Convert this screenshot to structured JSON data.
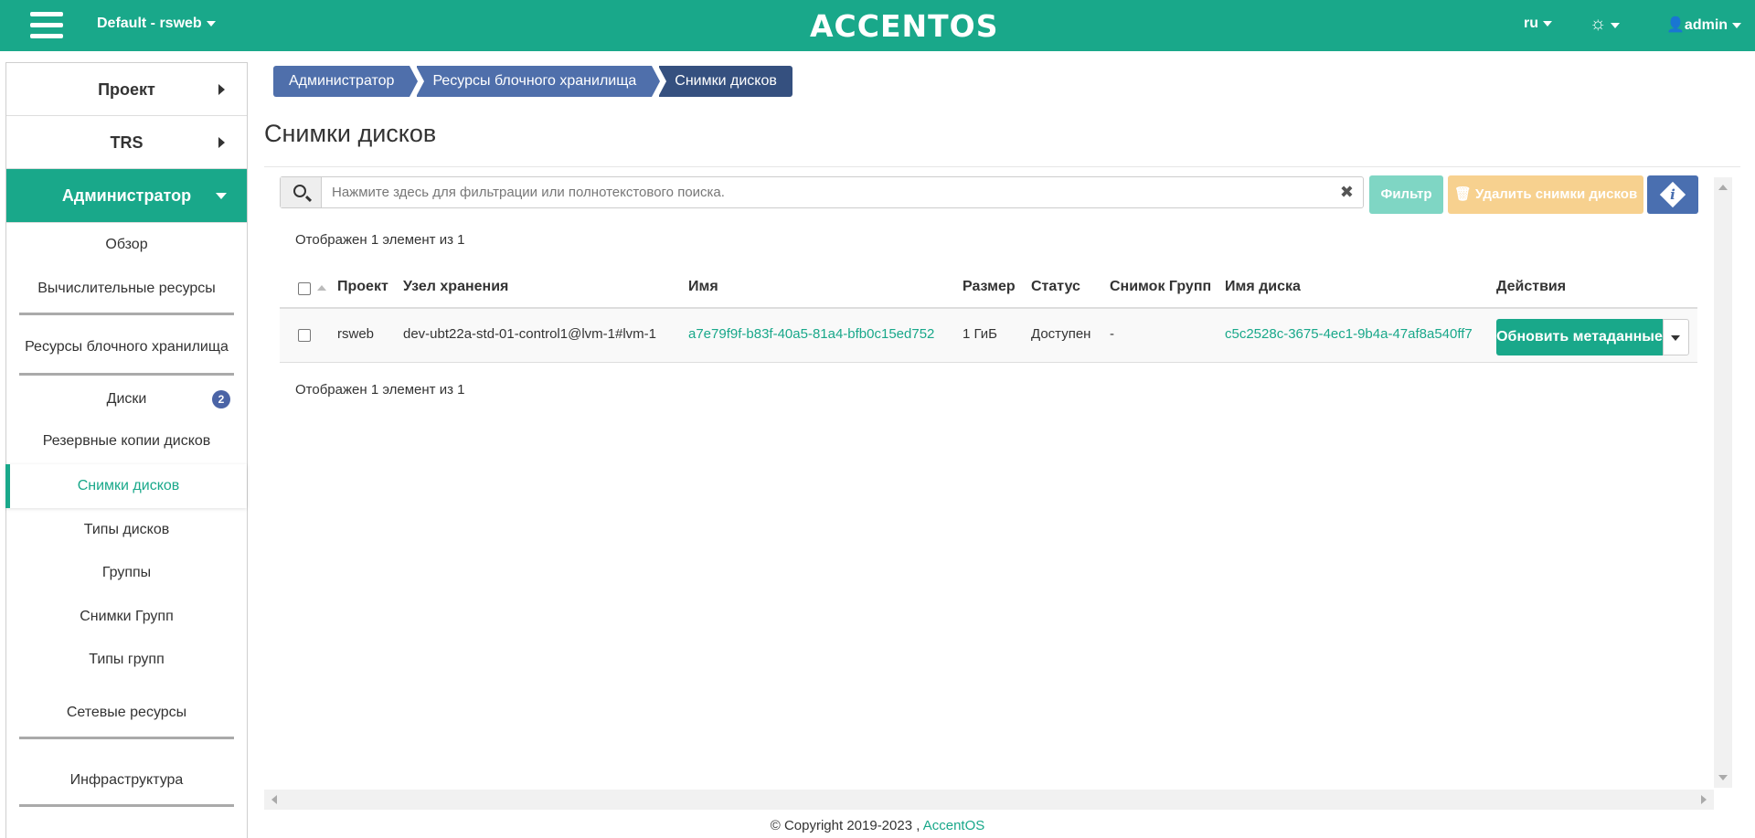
{
  "topbar": {
    "project_switch": "Default - rsweb",
    "logo": "ACCENTOS",
    "lang": "ru",
    "user": "admin"
  },
  "sidebar": {
    "project": "Проект",
    "trs": "TRS",
    "admin": "Администратор",
    "items": {
      "overview": "Обзор",
      "compute": "Вычислительные ресурсы",
      "block_storage": "Ресурсы блочного хранилища",
      "volumes": "Диски",
      "volumes_badge": "2",
      "backups": "Резервные копии дисков",
      "snapshots": "Снимки дисков",
      "volume_types": "Типы дисков",
      "groups": "Группы",
      "group_snapshots": "Снимки Групп",
      "group_types": "Типы групп",
      "network": "Сетевые ресурсы",
      "infrastructure": "Инфраструктура"
    }
  },
  "breadcrumb": [
    "Администратор",
    "Ресурсы блочного хранилища",
    "Снимки дисков"
  ],
  "page_title": "Снимки дисков",
  "search": {
    "placeholder": "Нажмите здесь для фильтрации или полнотекстового поиска."
  },
  "toolbar": {
    "filter": "Фильтр",
    "delete": "Удалить снимки дисков"
  },
  "count_text": "Отображен 1 элемент из 1",
  "table": {
    "headers": [
      "Проект",
      "Узел хранения",
      "Имя",
      "Размер",
      "Статус",
      "Снимок Групп",
      "Имя диска",
      "Действия"
    ],
    "row": {
      "project": "rsweb",
      "host": "dev-ubt22a-std-01-control1@lvm-1#lvm-1",
      "name": "a7e79f9f-b83f-40a5-81a4-bfb0c15ed752",
      "size": "1 ГиБ",
      "status": "Доступен",
      "group_snapshot": "-",
      "volume_name": "c5c2528c-3675-4ec1-9b4a-47af8a540ff7",
      "action": "Обновить метаданные"
    }
  },
  "footer": {
    "copyright": "© Copyright 2019-2023 ,",
    "link": "AccentOS"
  },
  "colors": {
    "accent": "#19a88a",
    "breadcrumb": "#4f6fab",
    "breadcrumb_active": "#35507f",
    "info_button": "#4a6fb0"
  }
}
